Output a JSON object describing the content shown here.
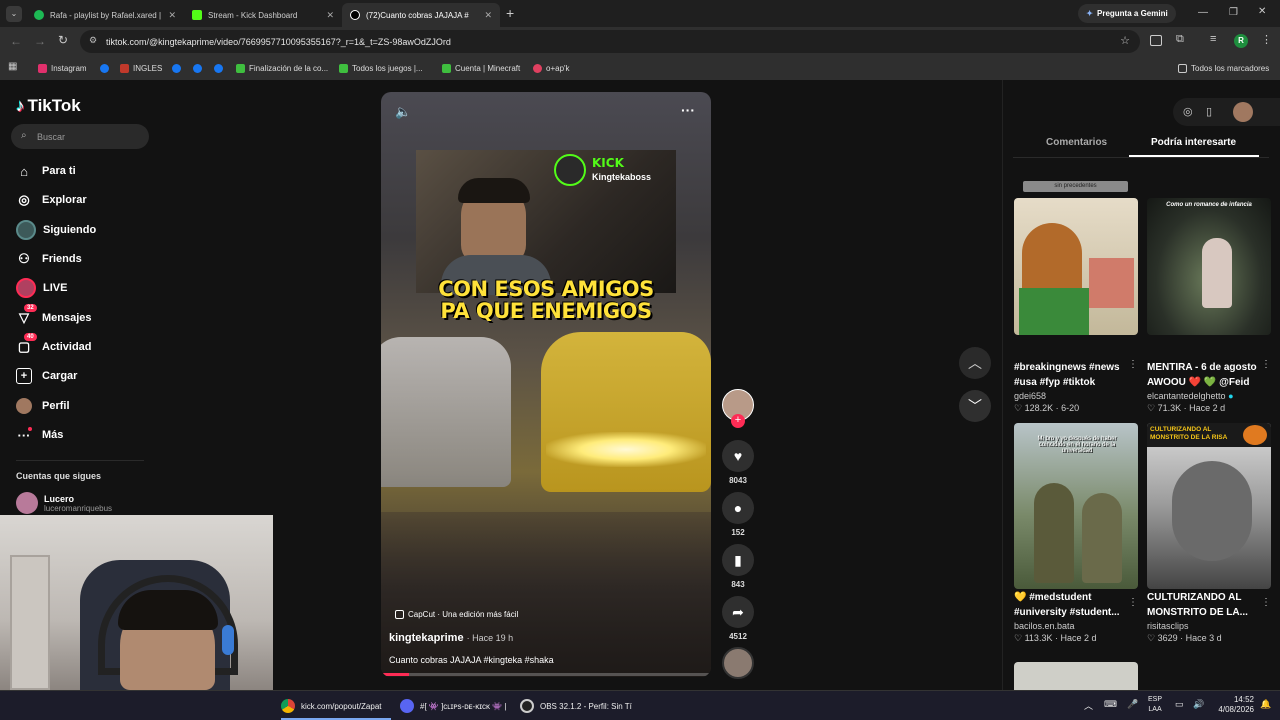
{
  "browser": {
    "tabs": [
      {
        "title": "Rafa - playlist by Rafael.xared |",
        "icon": "spotify-icon",
        "color": "#1db954"
      },
      {
        "title": "Stream - Kick Dashboard",
        "icon": "kick-icon",
        "color": "#53fc18"
      },
      {
        "title": "(72)Cuanto cobras JAJAJA #",
        "icon": "tiktok-icon",
        "color": "#ffffff"
      }
    ],
    "gemini_button": "Pregunta a Gemini",
    "url": "tiktok.com/@kingtekaprime/video/7669957710095355167?_r=1&_t=ZS-98awOdZJOrd",
    "profile_initial": "R",
    "bookmarks": [
      {
        "label": "Instagram",
        "color": "#e1306c"
      },
      {
        "label": "",
        "color": "#1877f2"
      },
      {
        "label": "INGLES",
        "color": "#c0392b"
      },
      {
        "label": "",
        "color": "#1877f2"
      },
      {
        "label": "",
        "color": "#1877f2"
      },
      {
        "label": "",
        "color": "#1877f2"
      },
      {
        "label": "Finalización de la co...",
        "color": "#3fbf3f"
      },
      {
        "label": "Todos los juegos |...",
        "color": "#3fbf3f"
      },
      {
        "label": "Cuenta | Minecraft",
        "color": "#3fbf3f"
      },
      {
        "label": "o+ap'k",
        "color": "#e04060"
      }
    ],
    "all_bookmarks": "Todos los marcadores"
  },
  "sidebar": {
    "logo": "TikTok",
    "search_placeholder": "Buscar",
    "items": [
      {
        "label": "Para ti",
        "icon": "home-icon"
      },
      {
        "label": "Explorar",
        "icon": "compass-icon"
      },
      {
        "label": "Siguiendo",
        "icon": "following-avatar-icon"
      },
      {
        "label": "Friends",
        "icon": "friends-icon"
      },
      {
        "label": "LIVE",
        "icon": "live-icon"
      },
      {
        "label": "Mensajes",
        "icon": "messages-icon",
        "badge": "32"
      },
      {
        "label": "Actividad",
        "icon": "activity-icon",
        "badge": "40"
      },
      {
        "label": "Cargar",
        "icon": "upload-icon"
      },
      {
        "label": "Perfil",
        "icon": "profile-avatar-icon"
      },
      {
        "label": "Más",
        "icon": "more-dots-icon"
      }
    ],
    "following_title": "Cuentas que sigues",
    "following": [
      {
        "name": "Lucero",
        "handle": "luceromanriquebus"
      }
    ]
  },
  "video": {
    "overlay_brand": "KICK",
    "overlay_user": "Kingtekaboss",
    "caption_line1": "CON ESOS AMIGOS",
    "caption_line2": "PA QUE ENEMIGOS",
    "capcut": "CapCut · Una edición más fácil",
    "author": "kingtekaprime",
    "time": "· Hace 19 h",
    "description": "Cuanto cobras JAJAJA #kingteka #shaka",
    "likes": "8043",
    "comments": "152",
    "saves": "843",
    "shares": "4512"
  },
  "right_panel": {
    "tab_comments": "Comentarios",
    "tab_interest": "Podría interesarte",
    "top_strip": "sin precedentes",
    "cards": [
      {
        "title": "#breakingnews #news #usa #fyp #tiktok",
        "user": "gdei658",
        "likes": "128.2K",
        "date": "6-20",
        "thumb_text": ""
      },
      {
        "title": "MENTIRA - 6 de agosto AWOOU ❤️ 💚 @Feid",
        "user": "elcantantedelghetto",
        "likes": "71.3K",
        "date": "Hace 2 d",
        "thumb_text": "Como un romance de infancia"
      },
      {
        "title": "💛 #medstudent #university #student...",
        "user": "bacilos.en.bata",
        "likes": "113.3K",
        "date": "Hace 2 d",
        "thumb_text": "Mi bro y yo después de haber coincidido en el horario de la universidad"
      },
      {
        "title": "CULTURIZANDO AL MONSTRITO DE LA...",
        "user": "risitasclips",
        "likes": "3629",
        "date": "Hace 3 d",
        "thumb_text": "CULTURIZANDO AL MONSTRITO DE LA RISA"
      }
    ]
  },
  "taskbar": {
    "apps": [
      {
        "label": "kick.com/popout/Zapat",
        "color": "#4285f4"
      },
      {
        "label": "#[ 👾 ]ᴄʟɪᴘs-ᴅᴇ-ᴋɪᴄᴋ 👾 |",
        "color": "#5865f2"
      },
      {
        "label": "OBS 32.1.2 - Perfil: Sin Tí",
        "color": "#444444"
      }
    ],
    "lang": "ESP",
    "lang2": "LAA",
    "time": "14:52",
    "date": "4/08/2026"
  }
}
